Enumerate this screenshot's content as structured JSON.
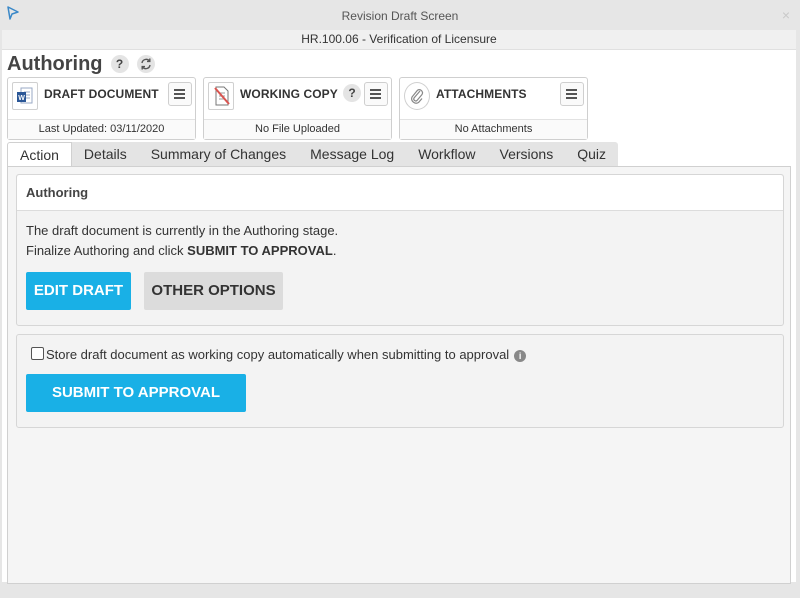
{
  "window": {
    "title": "Revision Draft Screen",
    "close_glyph": "×",
    "logo_icon": "play-arrow-icon"
  },
  "document_bar": {
    "label": "HR.100.06 - Verification of Licensure"
  },
  "header": {
    "title": "Authoring",
    "help_glyph": "?",
    "refresh_icon": "refresh-icon"
  },
  "cards": {
    "draft": {
      "title": "DRAFT DOCUMENT",
      "footer": "Last Updated: 03/11/2020",
      "icon": "word-document-icon"
    },
    "working": {
      "title": "WORKING COPY",
      "help_glyph": "?",
      "footer": "No File Uploaded",
      "icon": "no-file-icon"
    },
    "attachments": {
      "title": "ATTACHMENTS",
      "footer": "No Attachments",
      "icon": "paperclip-icon"
    }
  },
  "tabs": [
    "Action",
    "Details",
    "Summary of Changes",
    "Message Log",
    "Workflow",
    "Versions",
    "Quiz"
  ],
  "active_tab": "Action",
  "authoring_section": {
    "title": "Authoring",
    "line1": "The draft document is currently in the Authoring stage.",
    "line2_prefix": "Finalize Authoring and click ",
    "line2_bold": "SUBMIT TO APPROVAL",
    "line2_suffix": ".",
    "edit_button": "EDIT DRAFT",
    "options_button": "OTHER OPTIONS"
  },
  "submit_section": {
    "checkbox_label": "Store draft document as working copy automatically when submitting to approval",
    "checkbox_checked": false,
    "info_glyph": "i",
    "submit_button": "SUBMIT TO APPROVAL"
  },
  "colors": {
    "primary": "#19b0e6",
    "word_blue": "#2b5797",
    "no_file_red": "#d9534f"
  }
}
